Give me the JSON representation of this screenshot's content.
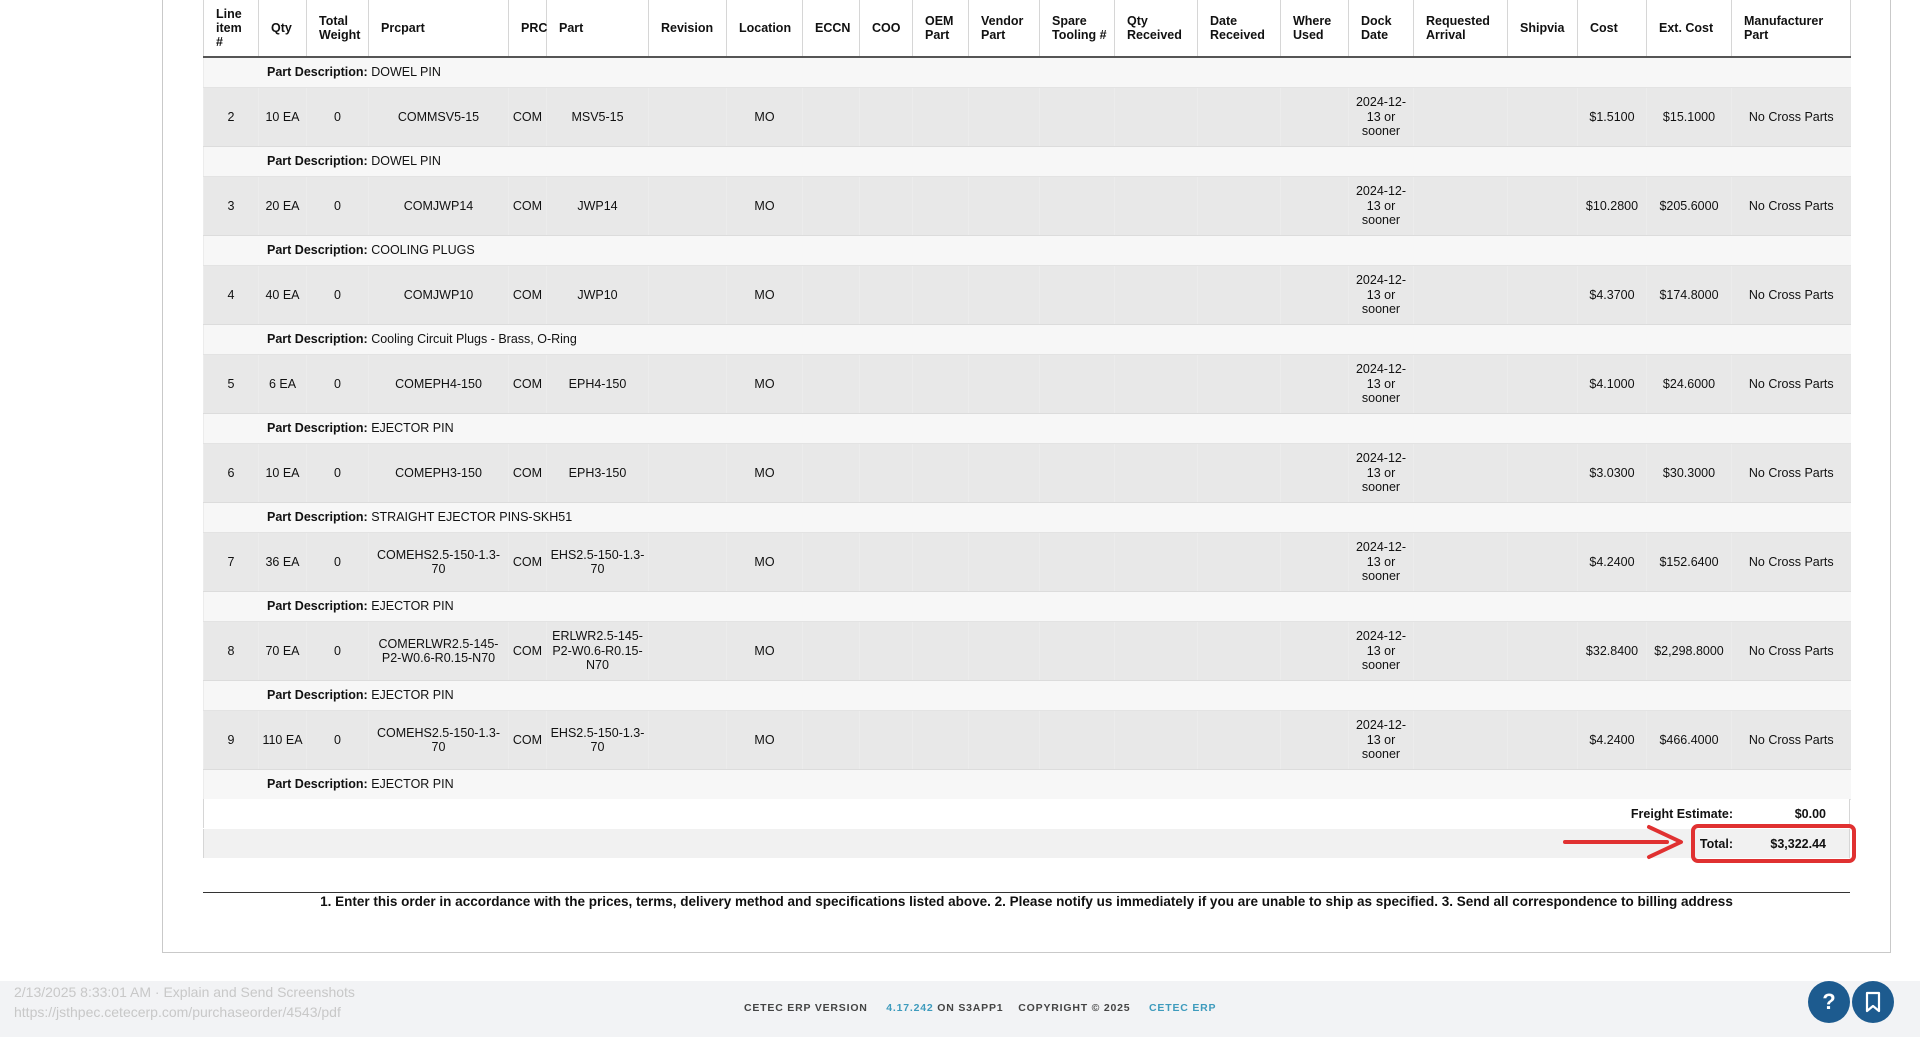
{
  "columns": [
    "Line item #",
    "Qty",
    "Total Weight",
    "Prcpart",
    "PRC",
    "Part",
    "Revision",
    "Location",
    "ECCN",
    "COO",
    "OEM Part",
    "Vendor Part",
    "Spare Tooling #",
    "Qty Received",
    "Date Received",
    "Where Used",
    "Dock Date",
    "Requested Arrival",
    "Shipvia",
    "Cost",
    "Ext. Cost",
    "Manufacturer Part"
  ],
  "desc_label": "Part Description:",
  "rows": [
    {
      "kind": "desc",
      "desc": "DOWEL PIN"
    },
    {
      "kind": "item",
      "cells": [
        "2",
        "10 EA",
        "0",
        "COMMSV5-15",
        "COM",
        "MSV5-15",
        "",
        "MO",
        "",
        "",
        "",
        "",
        "",
        "",
        "",
        "",
        "2024-12-13 or sooner",
        "",
        "",
        "$1.5100",
        "$15.1000",
        "No Cross Parts"
      ]
    },
    {
      "kind": "desc",
      "desc": "DOWEL PIN"
    },
    {
      "kind": "item",
      "cells": [
        "3",
        "20 EA",
        "0",
        "COMJWP14",
        "COM",
        "JWP14",
        "",
        "MO",
        "",
        "",
        "",
        "",
        "",
        "",
        "",
        "",
        "2024-12-13 or sooner",
        "",
        "",
        "$10.2800",
        "$205.6000",
        "No Cross Parts"
      ]
    },
    {
      "kind": "desc",
      "desc": "COOLING PLUGS"
    },
    {
      "kind": "item",
      "cells": [
        "4",
        "40 EA",
        "0",
        "COMJWP10",
        "COM",
        "JWP10",
        "",
        "MO",
        "",
        "",
        "",
        "",
        "",
        "",
        "",
        "",
        "2024-12-13 or sooner",
        "",
        "",
        "$4.3700",
        "$174.8000",
        "No Cross Parts"
      ]
    },
    {
      "kind": "desc",
      "desc": "Cooling Circuit Plugs - Brass, O-Ring"
    },
    {
      "kind": "item",
      "cells": [
        "5",
        "6 EA",
        "0",
        "COMEPH4-150",
        "COM",
        "EPH4-150",
        "",
        "MO",
        "",
        "",
        "",
        "",
        "",
        "",
        "",
        "",
        "2024-12-13 or sooner",
        "",
        "",
        "$4.1000",
        "$24.6000",
        "No Cross Parts"
      ]
    },
    {
      "kind": "desc",
      "desc": "EJECTOR PIN"
    },
    {
      "kind": "item",
      "cells": [
        "6",
        "10 EA",
        "0",
        "COMEPH3-150",
        "COM",
        "EPH3-150",
        "",
        "MO",
        "",
        "",
        "",
        "",
        "",
        "",
        "",
        "",
        "2024-12-13 or sooner",
        "",
        "",
        "$3.0300",
        "$30.3000",
        "No Cross Parts"
      ]
    },
    {
      "kind": "desc",
      "desc": "STRAIGHT EJECTOR PINS-SKH51"
    },
    {
      "kind": "item",
      "cells": [
        "7",
        "36 EA",
        "0",
        "COMEHS2.5-150-1.3-70",
        "COM",
        "EHS2.5-150-1.3-70",
        "",
        "MO",
        "",
        "",
        "",
        "",
        "",
        "",
        "",
        "",
        "2024-12-13 or sooner",
        "",
        "",
        "$4.2400",
        "$152.6400",
        "No Cross Parts"
      ]
    },
    {
      "kind": "desc",
      "desc": "EJECTOR PIN"
    },
    {
      "kind": "item",
      "cells": [
        "8",
        "70 EA",
        "0",
        "COMERLWR2.5-145-P2-W0.6-R0.15-N70",
        "COM",
        "ERLWR2.5-145-P2-W0.6-R0.15-N70",
        "",
        "MO",
        "",
        "",
        "",
        "",
        "",
        "",
        "",
        "",
        "2024-12-13 or sooner",
        "",
        "",
        "$32.8400",
        "$2,298.8000",
        "No Cross Parts"
      ]
    },
    {
      "kind": "desc",
      "desc": "EJECTOR PIN"
    },
    {
      "kind": "item",
      "cells": [
        "9",
        "110 EA",
        "0",
        "COMEHS2.5-150-1.3-70",
        "COM",
        "EHS2.5-150-1.3-70",
        "",
        "MO",
        "",
        "",
        "",
        "",
        "",
        "",
        "",
        "",
        "2024-12-13 or sooner",
        "",
        "",
        "$4.2400",
        "$466.4000",
        "No Cross Parts"
      ]
    },
    {
      "kind": "desc",
      "desc": "EJECTOR PIN"
    }
  ],
  "totals": {
    "freight_label": "Freight Estimate:",
    "freight_value": "$0.00",
    "total_label": "Total:",
    "total_value": "$3,322.44"
  },
  "terms": "1. Enter this order in accordance with the prices, terms, delivery method and specifications listed above. 2. Please notify us immediately if you are unable to ship as specified. 3. Send all correspondence to billing address",
  "footer": {
    "version_prefix": "CETEC ERP VERSION",
    "version": "4.17.242",
    "server": "ON S3APP1",
    "copyright": "COPYRIGHT © 2025",
    "brand": "CETEC ERP"
  },
  "overlay": {
    "line1": "2/13/2025 8:33:01 AM · Explain and Send Screenshots",
    "line2": "https://jsthpec.cetecerp.com/purchaseorder/4543/pdf"
  },
  "buttons": {
    "help": "?"
  },
  "colors": {
    "highlight": "#e03131",
    "footer_link": "#3e9bbd",
    "button": "#1d5b8f"
  }
}
